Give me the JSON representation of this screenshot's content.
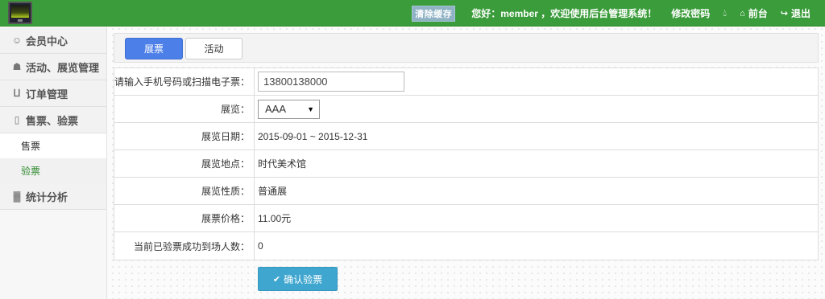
{
  "header": {
    "clear_cache": "清除缓存",
    "greeting": "您好：member ，欢迎使用后台管理系统！",
    "change_password": "修改密码",
    "front": "前台",
    "logout": "退出",
    "bg_color": "#3a9c3a"
  },
  "sidebar": {
    "items": [
      {
        "label": "会员中心",
        "icon": "user-icon"
      },
      {
        "label": "活动、展览管理",
        "icon": "trophy-icon"
      },
      {
        "label": "订单管理",
        "icon": "cart-icon"
      },
      {
        "label": "售票、验票",
        "icon": "phone-icon"
      },
      {
        "label": "统计分析",
        "icon": "bar-chart-icon"
      }
    ],
    "subitems": [
      {
        "label": "售票",
        "active": false
      },
      {
        "label": "验票",
        "active": true
      }
    ]
  },
  "tabs": [
    {
      "label": "展票",
      "active": true
    },
    {
      "label": "活动",
      "active": false
    }
  ],
  "form": {
    "phone_label": "请输入手机号码或扫描电子票：",
    "phone_value": "13800138000",
    "exhibition_label": "展览：",
    "exhibition_value": "AAA",
    "date_label": "展览日期：",
    "date_value": "2015-09-01 ~ 2015-12-31",
    "location_label": "展览地点：",
    "location_value": "时代美术馆",
    "nature_label": "展览性质：",
    "nature_value": "普通展",
    "price_label": "展票价格：",
    "price_value": "11.00元",
    "count_label": "当前已验票成功到场人数：",
    "count_value": "0"
  },
  "submit": {
    "label": "确认验票",
    "color": "#3fa6cf"
  }
}
